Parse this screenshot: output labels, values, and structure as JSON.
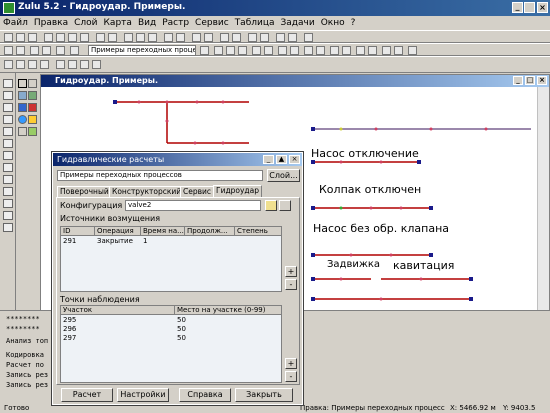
{
  "window": {
    "title": "Zulu 5.2 - Гидроудар. Примеры."
  },
  "menu": [
    "Файл",
    "Правка",
    "Слой",
    "Карта",
    "Вид",
    "Растр",
    "Сервис",
    "Таблица",
    "Задачи",
    "Окно",
    "?"
  ],
  "toolbar": {
    "layer_combo": "Примеры переходных процессов"
  },
  "map": {
    "title": "Гидроудар. Примеры.",
    "labels": [
      "Насос отключение",
      "Колпак отключен",
      "Насос без обр. клапана",
      "Задвижка",
      "кавитация"
    ]
  },
  "dialog": {
    "title": "Гидравлические расчеты",
    "layer_field": "Примеры переходных процессов",
    "layer_button": "Слой...",
    "tabs": [
      "Поверочный",
      "Конструкторский",
      "Сервис",
      "Гидроудар"
    ],
    "config_label": "Конфигурация",
    "config_value": "valve2",
    "sources_label": "Источники возмущения",
    "sources_columns": [
      "ID",
      "Операция",
      "Время на...",
      "Продолж...",
      "Степень"
    ],
    "sources_rows": [
      [
        "291",
        "Закрытие",
        "1",
        "",
        ""
      ]
    ],
    "points_label": "Точки наблюдения",
    "points_columns": [
      "Участок",
      "Место на участке (0-99)"
    ],
    "points_rows": [
      [
        "295",
        "50"
      ],
      [
        "296",
        "50"
      ],
      [
        "297",
        "50"
      ]
    ],
    "buttons": [
      "Расчет",
      "Настройки",
      "Справка",
      "Закрыть"
    ]
  },
  "console": {
    "lines": [
      "********",
      "********",
      "Анализ топ",
      "Кодировка",
      "Расчет по",
      "Запись рез",
      "Запись рез"
    ]
  },
  "status": {
    "ready": "Готово",
    "layer": "Правка: Примеры переходных процесс",
    "x": "X: 5466.92 м",
    "y": "Y: 9403.5"
  }
}
